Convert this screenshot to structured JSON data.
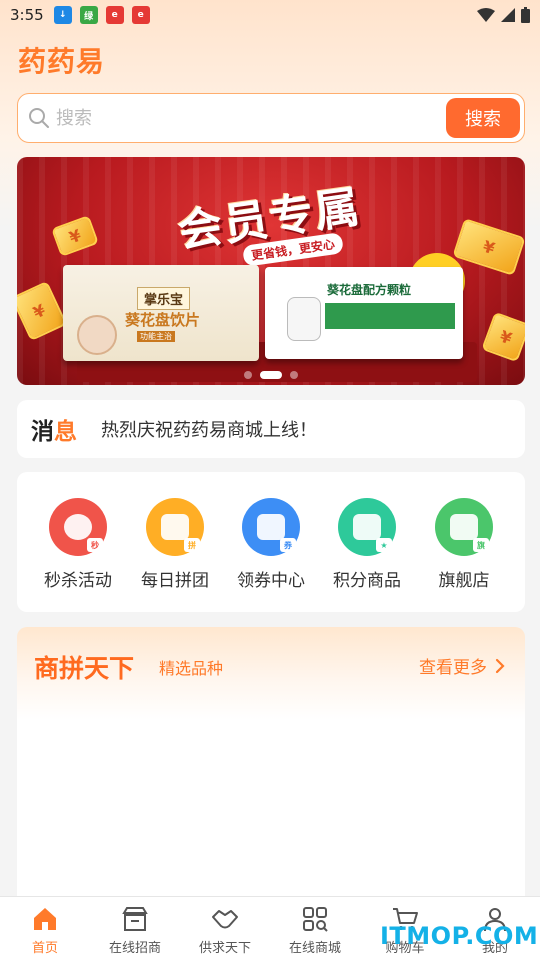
{
  "status_bar": {
    "time": "3:55",
    "icons": [
      "download-app-icon",
      "green-app-icon",
      "red-app-icon",
      "red-app-icon-2",
      "wifi-icon",
      "signal-icon",
      "battery-icon"
    ]
  },
  "header": {
    "app_title": "药药易"
  },
  "search": {
    "placeholder": "搜索",
    "button_label": "搜索"
  },
  "banner": {
    "headline": "会员专属",
    "subtitle": "更省钱，更安心",
    "left_product": {
      "brand": "掌乐宝",
      "name": "葵花盘饮片",
      "tag": "功能主治"
    },
    "right_product": {
      "name": "葵花盘配方颗粒"
    },
    "coin_symbol": "¥",
    "dots": 3,
    "active_dot": 1
  },
  "notice": {
    "label_part1": "消",
    "label_part2": "息",
    "text": "热烈庆祝药药易商城上线！"
  },
  "quick_entries": [
    {
      "label": "秒杀活动",
      "icon": "alarm-clock-icon",
      "color": "#f0544a",
      "badge": "秒"
    },
    {
      "label": "每日拼团",
      "icon": "shopping-bag-icon",
      "color": "#ffae25",
      "badge": "拼"
    },
    {
      "label": "领券中心",
      "icon": "coupon-icon",
      "color": "#3d8ef5",
      "badge": "券"
    },
    {
      "label": "积分商品",
      "icon": "gift-icon",
      "color": "#2ec99a",
      "badge": "★"
    },
    {
      "label": "旗舰店",
      "icon": "store-icon",
      "color": "#4bc66b",
      "badge": "旗"
    }
  ],
  "section": {
    "title": "商拼天下",
    "subtitle": "精选品种",
    "more_label": "查看更多"
  },
  "bottom_nav": [
    {
      "label": "首页",
      "icon": "home-icon",
      "active": true
    },
    {
      "label": "在线招商",
      "icon": "storefront-icon",
      "active": false
    },
    {
      "label": "供求天下",
      "icon": "handshake-icon",
      "active": false
    },
    {
      "label": "在线商城",
      "icon": "grid-search-icon",
      "active": false
    },
    {
      "label": "购物车",
      "icon": "cart-icon",
      "active": false
    },
    {
      "label": "我的",
      "icon": "user-icon",
      "active": false
    }
  ],
  "watermark": "ITMOP.COM",
  "colors": {
    "accent": "#ff7a2a",
    "search_button": "#ff6a2f"
  }
}
